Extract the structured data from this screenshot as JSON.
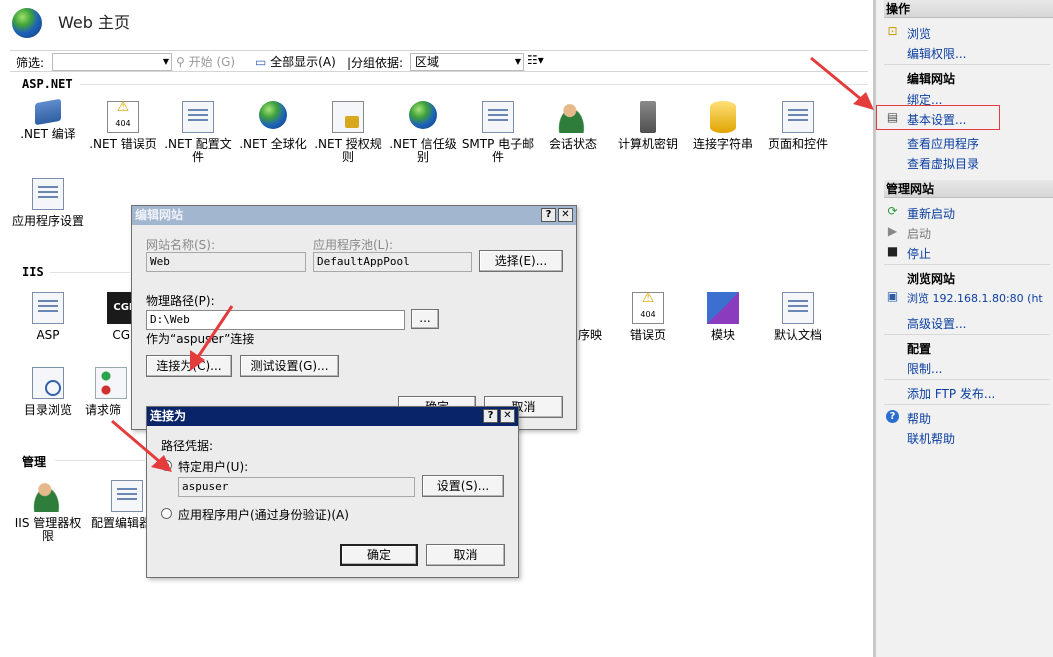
{
  "header": {
    "title": "Web 主页"
  },
  "toolbar": {
    "filter_label": "筛选:",
    "filter_value": "",
    "start_label": "开始 (G)",
    "show_all_label": "全部显示(A)",
    "group_label": "|分组依据:",
    "group_value": "区域",
    "view_icon": "view-list-icon"
  },
  "sections": {
    "aspnet": "ASP.NET",
    "iis": "IIS",
    "manage": "管理"
  },
  "aspnet_features": [
    {
      "label": ".NET 编译",
      "icon": "net-compile-icon"
    },
    {
      "label": ".NET 错误页",
      "icon": "net-error-pages-icon"
    },
    {
      "label": ".NET 配置文件",
      "icon": "net-profile-icon"
    },
    {
      "label": ".NET 全球化",
      "icon": "net-globalization-icon"
    },
    {
      "label": ".NET 授权规则",
      "icon": "net-authorization-icon"
    },
    {
      "label": ".NET 信任级别",
      "icon": "net-trust-levels-icon"
    },
    {
      "label": "SMTP 电子邮件",
      "icon": "smtp-email-icon"
    },
    {
      "label": "会话状态",
      "icon": "session-state-icon"
    },
    {
      "label": "计算机密钥",
      "icon": "machine-key-icon"
    },
    {
      "label": "连接字符串",
      "icon": "connection-strings-icon"
    },
    {
      "label": "页面和控件",
      "icon": "pages-controls-icon"
    },
    {
      "label": "应用程序设置",
      "icon": "app-settings-icon"
    }
  ],
  "iis_features": [
    {
      "label": "ASP",
      "icon": "asp-icon"
    },
    {
      "label": "CGI",
      "icon": "cgi-icon"
    },
    {
      "label": "序映",
      "icon": "handler-mappings-icon"
    },
    {
      "label": "错误页",
      "icon": "error-pages-icon"
    },
    {
      "label": "模块",
      "icon": "modules-icon"
    },
    {
      "label": "默认文档",
      "icon": "default-document-icon"
    },
    {
      "label": "目录浏览",
      "icon": "directory-browsing-icon"
    },
    {
      "label": "请求筛",
      "icon": "request-filtering-icon"
    }
  ],
  "manage_features": [
    {
      "label": "IIS 管理器权限",
      "icon": "iis-manager-permissions-icon"
    },
    {
      "label": "配置编辑器",
      "icon": "config-editor-icon"
    }
  ],
  "actions": {
    "header": "操作",
    "browse": "浏览",
    "edit_permissions": "编辑权限...",
    "edit_site": "编辑网站",
    "bindings": "绑定...",
    "basic_settings": "基本设置...",
    "view_applications": "查看应用程序",
    "view_vdirs": "查看虚拟目录",
    "manage_site_header": "管理网站",
    "restart": "重新启动",
    "start": "启动",
    "stop": "停止",
    "browse_site": "浏览网站",
    "browse_url": "浏览 192.168.1.80:80 (ht",
    "advanced_settings": "高级设置...",
    "configure": "配置",
    "limits": "限制...",
    "add_ftp": "添加 FTP 发布...",
    "help": "帮助",
    "online_help": "联机帮助"
  },
  "edit_site_dialog": {
    "title": "编辑网站",
    "site_name_label": "网站名称(S):",
    "site_name": "Web",
    "app_pool_label": "应用程序池(L):",
    "app_pool": "DefaultAppPool",
    "select_button": "选择(E)...",
    "physical_path_label": "物理路径(P):",
    "physical_path": "D:\\Web",
    "browse_button": "...",
    "connect_as_text": "作为“aspuser”连接",
    "connect_as_button": "连接为(C)...",
    "test_settings_button": "测试设置(G)...",
    "ok_button": "确定",
    "cancel_button": "取消",
    "help_glyph": "?",
    "close_glyph": "✕"
  },
  "connect_as_dialog": {
    "title": "连接为",
    "credentials_label": "路径凭据:",
    "specific_user_label": "特定用户(U):",
    "specific_user_value": "aspuser",
    "set_button": "设置(S)...",
    "app_user_label": "应用程序用户(通过身份验证)(A)",
    "ok_button": "确定",
    "cancel_button": "取消",
    "selected_option": "specific_user",
    "help_glyph": "?",
    "close_glyph": "✕"
  },
  "colors": {
    "annotation_red": "#e43c3c",
    "dialog_active_title": "#0a246a",
    "dialog_inactive_title": "#a3b6cf",
    "link_blue": "#0b3ea1"
  }
}
